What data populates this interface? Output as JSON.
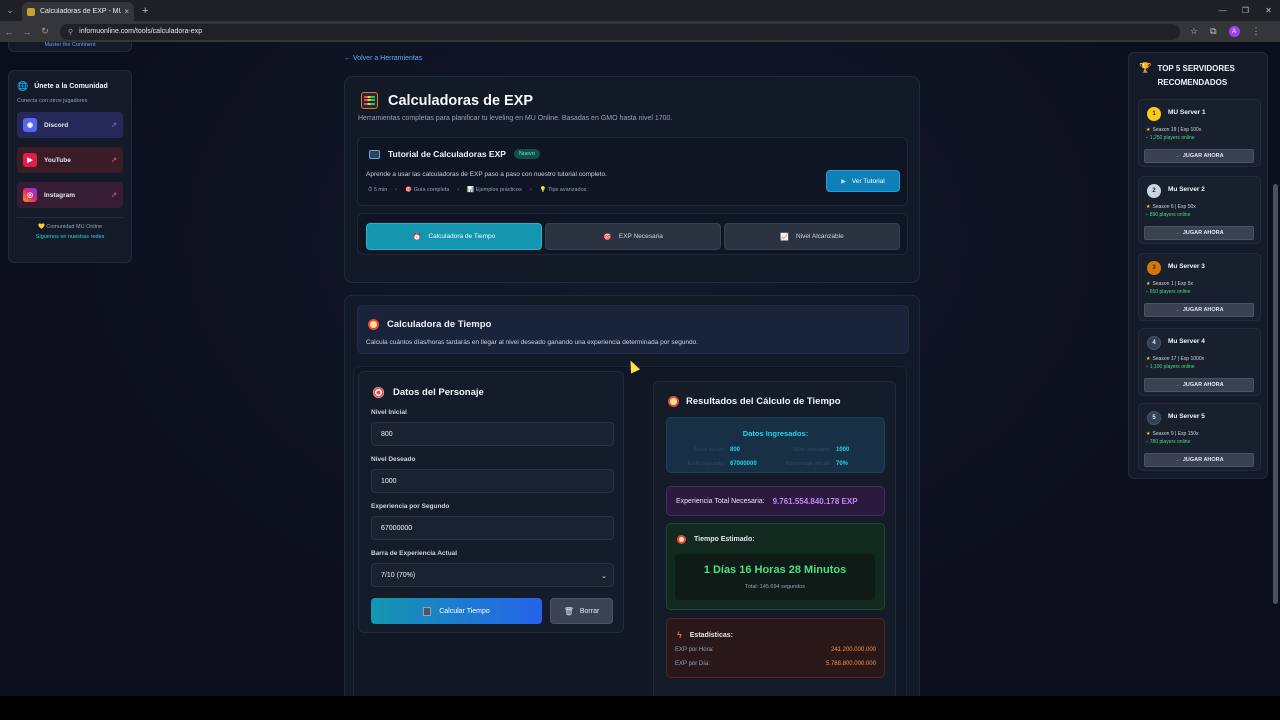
{
  "browser": {
    "tab_title": "Calculadoras de EXP - MU Onl",
    "tab_close": "×",
    "new_tab": "+",
    "url": "infomuonline.com/tools/calculadora-exp",
    "profile_initial": "A"
  },
  "sidebar_left": {
    "top_text": "Master the Continent",
    "title": "Únete a la Comunidad",
    "subtitle": "Conecta con otros jugadores",
    "socials": [
      {
        "label": "Discord",
        "icon": "discord-icon"
      },
      {
        "label": "YouTube",
        "icon": "youtube-icon"
      },
      {
        "label": "Instagram",
        "icon": "instagram-icon"
      }
    ],
    "community": "💛 Comunidad MU Online",
    "follow": "Síguenos en nuestras redes"
  },
  "main": {
    "back_link": "← Volver a Herramientas",
    "title": "Calculadoras de EXP",
    "subtitle": "Herramientas completas para planificar tu leveling en MU Online. Basadas en GMO hasta nivel 1700.",
    "tutorial": {
      "title": "Tutorial de Calculadoras EXP",
      "badge": "Nuevo",
      "desc": "Aprende a usar las calculadoras de EXP paso a paso con nuestro tutorial completo.",
      "meta": [
        "⏱ 5 min",
        "🎯 Guía completa",
        "📊 Ejemplos prácticos",
        "💡 Tips avanzados"
      ],
      "button": "Ver Tutorial"
    },
    "tabs": [
      {
        "label": "Calculadora de Tiempo",
        "icon": "⏰",
        "active": true
      },
      {
        "label": "EXP Necesaria",
        "icon": "🎯",
        "active": false
      },
      {
        "label": "Nivel Alcanzable",
        "icon": "📈",
        "active": false
      }
    ],
    "calc": {
      "title": "Calculadora de Tiempo",
      "desc": "Calcula cuántos días/horas tardarás en llegar al nivel deseado ganando una experiencia determinada por segundo."
    },
    "form": {
      "title": "Datos del Personaje",
      "fields": [
        {
          "label": "Nivel Inicial",
          "value": "800"
        },
        {
          "label": "Nivel Deseado",
          "value": "1000"
        },
        {
          "label": "Experiencia por Segundo",
          "value": "67000000"
        },
        {
          "label": "Barra de Experiencia Actual",
          "value": "7/10 (70%)"
        }
      ],
      "calc_button": "Calcular Tiempo",
      "clear_button": "Borrar"
    },
    "results": {
      "title": "Resultados del Cálculo de Tiempo",
      "datos_title": "Datos Ingresados:",
      "datos": [
        {
          "k": "Nivel inicial:",
          "v": "800"
        },
        {
          "k": "Nivel deseado:",
          "v": "1000"
        },
        {
          "k": "EXP/segundo:",
          "v": "67000000"
        },
        {
          "k": "Porcentaje inicial:",
          "v": "70%"
        }
      ],
      "total_label": "Experiencia Total Necesaria:",
      "total_value": "9.761.554.840.178 EXP",
      "tiempo_label": "Tiempo Estimado:",
      "tiempo_value": "1 Días 16 Horas 28 Minutos",
      "tiempo_total": "Total: 145.694 segundos",
      "stats_label": "Estadísticas:",
      "stats": [
        {
          "k": "EXP por Hora:",
          "v": "241.200.000.000"
        },
        {
          "k": "EXP por Día:",
          "v": "5.788.800.000.000"
        }
      ]
    }
  },
  "sidebar_right": {
    "title_line1": "TOP 5 SERVIDORES",
    "title_line2": "RECOMENDADOS",
    "play_label": "JUGAR AHORA",
    "servers": [
      {
        "rank": "1",
        "name": "MU Server 1",
        "info": "Season 19 | Exp 100x",
        "online": "1,250 players online",
        "color": "#facc15"
      },
      {
        "rank": "2",
        "name": "Mu Server 2",
        "info": "Season 6 | Exp 50x",
        "online": "890 players online",
        "color": "#cbd5e1"
      },
      {
        "rank": "3",
        "name": "Mu Server 3",
        "info": "Season 1 | Exp 5x",
        "online": "650 players online",
        "color": "#d97706"
      },
      {
        "rank": "4",
        "name": "Mu Server 4",
        "info": "Season 17 | Exp 1000x",
        "online": "1,100 players online",
        "color": "#334155"
      },
      {
        "rank": "5",
        "name": "Mu Server 5",
        "info": "Season 9 | Exp 150x",
        "online": "780 players online",
        "color": "#334155"
      }
    ]
  }
}
